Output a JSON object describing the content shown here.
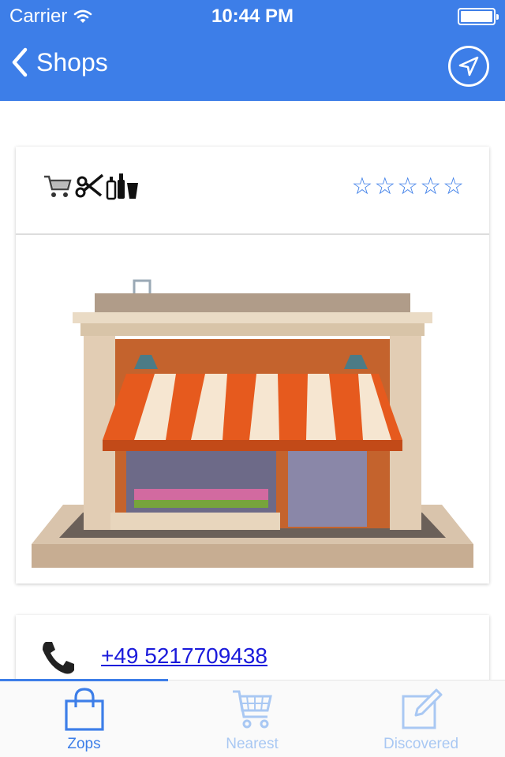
{
  "status_bar": {
    "carrier": "Carrier",
    "time": "10:44 PM"
  },
  "nav": {
    "back_label": "Shops",
    "location_icon": "location-arrow-icon"
  },
  "shop": {
    "category_icons": [
      "shopping-cart-icon",
      "scissors-icon",
      "bottles-icon"
    ],
    "rating": {
      "filled": 0,
      "max": 5
    },
    "image": "shop-storefront-image",
    "phone": "+49 5217709438"
  },
  "tabs": [
    {
      "label": "Zops",
      "icon": "shopping-bag-icon",
      "active": true
    },
    {
      "label": "Nearest",
      "icon": "shopping-cart-icon",
      "active": false
    },
    {
      "label": "Discovered",
      "icon": "edit-icon",
      "active": false
    }
  ],
  "colors": {
    "primary": "#3d7ee8",
    "inactive_tab": "#a9c8f3",
    "link": "#1a1adb"
  }
}
